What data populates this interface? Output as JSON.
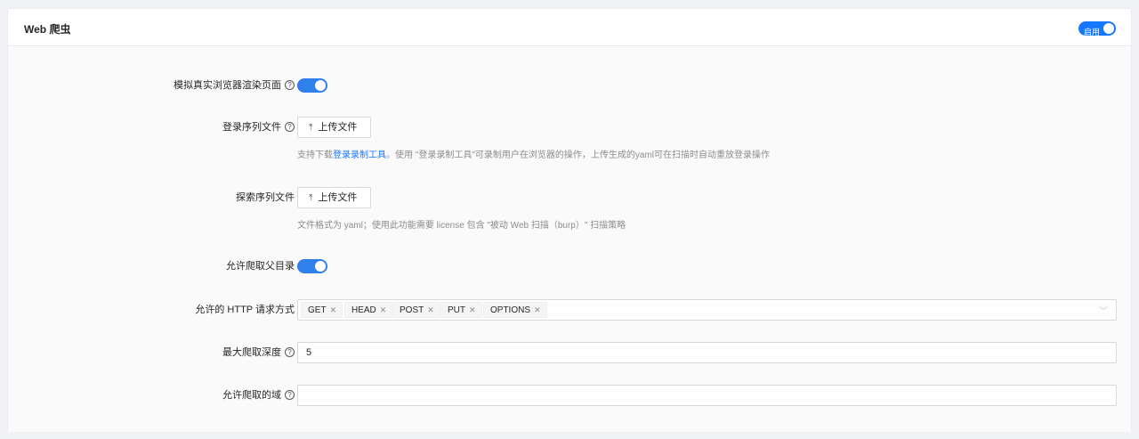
{
  "header": {
    "title": "Web 爬虫",
    "switch_label": "启用",
    "switch_on": true
  },
  "form": {
    "simulate_browser": {
      "label": "模拟真实浏览器渲染页面",
      "enabled": true
    },
    "login_sequence": {
      "label": "登录序列文件",
      "upload_label": "上传文件",
      "hint_prefix": "支持下载",
      "hint_link": "登录录制工具",
      "hint_suffix": "。使用 \"登录录制工具\"可录制用户在浏览器的操作，上传生成的yaml可在扫描时自动重放登录操作"
    },
    "explore_sequence": {
      "label": "探索序列文件",
      "upload_label": "上传文件",
      "hint": "文件格式为 yaml；使用此功能需要 license 包含 \"被动 Web 扫描（burp）\" 扫描策略"
    },
    "allow_parent_dir": {
      "label": "允许爬取父目录",
      "enabled": true
    },
    "http_methods": {
      "label": "允许的 HTTP 请求方式",
      "tags": [
        "GET",
        "HEAD",
        "POST",
        "PUT",
        "OPTIONS"
      ]
    },
    "max_depth": {
      "label": "最大爬取深度",
      "value": "5"
    },
    "allowed_domains": {
      "label": "允许爬取的域",
      "value": ""
    }
  },
  "icons": {
    "help": "question-circle-icon",
    "upload": "upload-icon",
    "close": "close-icon",
    "dropdown": "chevron-down-icon"
  },
  "colors": {
    "primary": "#1677ff",
    "switch_on": "#2f80ed",
    "hint": "#8c8c8c"
  }
}
